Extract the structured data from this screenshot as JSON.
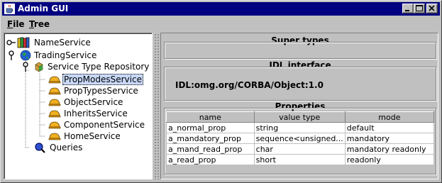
{
  "window": {
    "title": "Admin GUI",
    "controls": [
      "minimize",
      "maximize",
      "close"
    ]
  },
  "menu": {
    "file": {
      "mnemonic": "F",
      "rest": "ile"
    },
    "tree": {
      "mnemonic": "T",
      "rest": "ree"
    }
  },
  "tree": {
    "name_service": "NameService",
    "trading_service": "TradingService",
    "service_type_repository": "Service Type Repository",
    "children": [
      "PropModesService",
      "PropTypesService",
      "ObjectService",
      "InheritsService",
      "ComponentService",
      "HomeService"
    ],
    "queries": "Queries",
    "selected": "PropModesService"
  },
  "panels": {
    "super_types_title": "Super types",
    "idl_interface_title": "IDL interface",
    "idl_value": "IDL:omg.org/CORBA/Object:1.0",
    "properties_title": "Properties"
  },
  "properties": {
    "columns": [
      "name",
      "value type",
      "mode"
    ],
    "rows": [
      [
        "a_normal_prop",
        "string",
        "default"
      ],
      [
        "a_mandatory_prop",
        "sequence<unsigned...",
        "mandatory"
      ],
      [
        "a_mand_read_prop",
        "char",
        "mandatory readonly"
      ],
      [
        "a_read_prop",
        "short",
        "readonly"
      ]
    ]
  },
  "colors": {
    "titlebar": "#000080",
    "window_bg": "#c0c0c0",
    "selection": "#c8d8f8"
  },
  "icons": {
    "app": "java-cup-icon",
    "name_service": "books-icon",
    "trading_service": "globe-icon",
    "repository": "cube-icon",
    "service_type": "helmet-icon",
    "queries": "magnifier-icon"
  }
}
